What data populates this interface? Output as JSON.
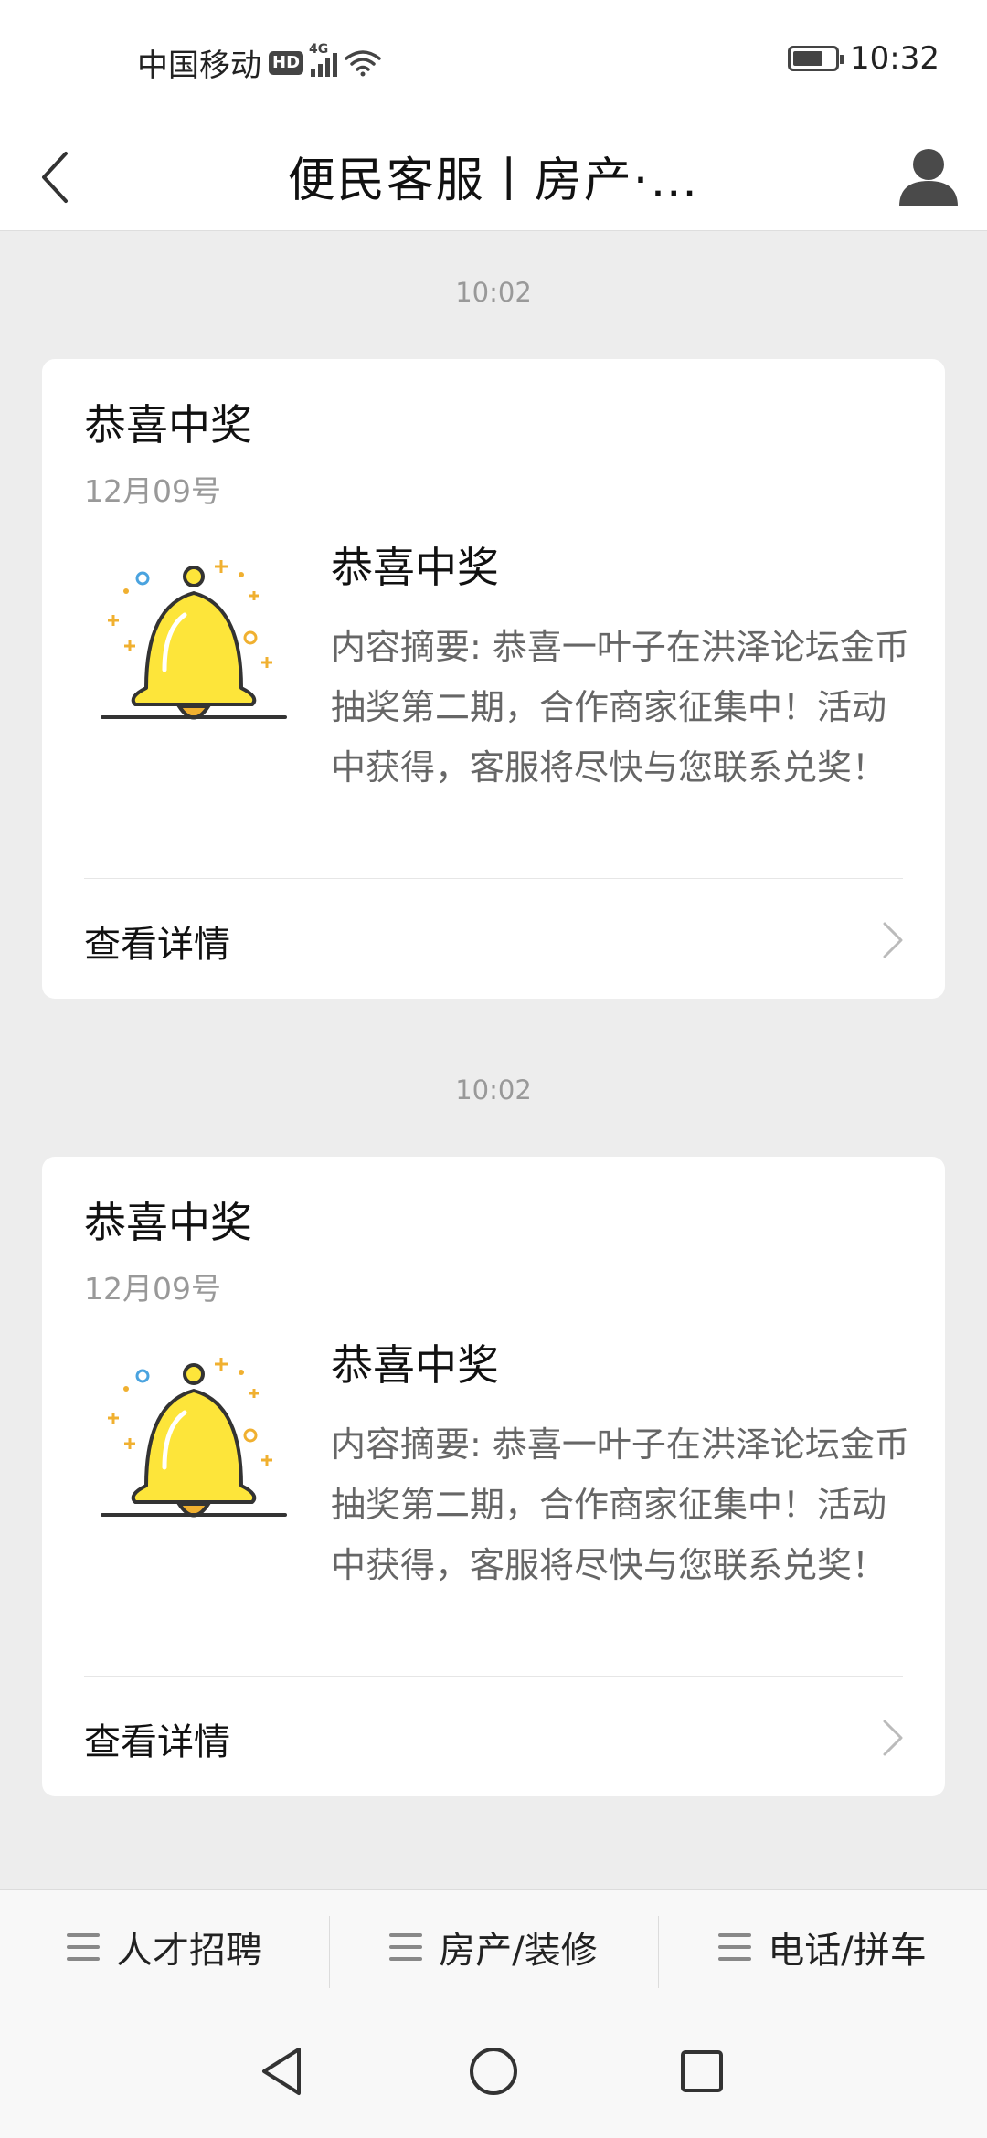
{
  "status_bar": {
    "carrier": "中国移动",
    "hd": "HD",
    "network": "4G",
    "time": "10:32",
    "battery_level": 0.75
  },
  "header": {
    "title": "便民客服丨房产·…"
  },
  "messages": [
    {
      "timestamp": "10:02",
      "card_title": "恭喜中奖",
      "date": "12月09号",
      "item_title": "恭喜中奖",
      "summary": "内容摘要: 恭喜一叶子在洪泽论坛金币抽奖第二期，合作商家征集中！活动中获得，客服将尽快与您联系兑奖！",
      "detail_label": "查看详情"
    },
    {
      "timestamp": "10:02",
      "card_title": "恭喜中奖",
      "date": "12月09号",
      "item_title": "恭喜中奖",
      "summary": "内容摘要: 恭喜一叶子在洪泽论坛金币抽奖第二期，合作商家征集中！活动中获得，客服将尽快与您联系兑奖！",
      "detail_label": "查看详情"
    }
  ],
  "bottom_menu": {
    "items": [
      {
        "label": "人才招聘",
        "icon": "menu-icon"
      },
      {
        "label": "房产/装修",
        "icon": "menu-icon"
      },
      {
        "label": "电话/拼车",
        "icon": "menu-icon"
      }
    ]
  },
  "colors": {
    "background": "#ededed",
    "card": "#ffffff",
    "bell_yellow": "#fde53a",
    "muted_text": "#999999"
  }
}
